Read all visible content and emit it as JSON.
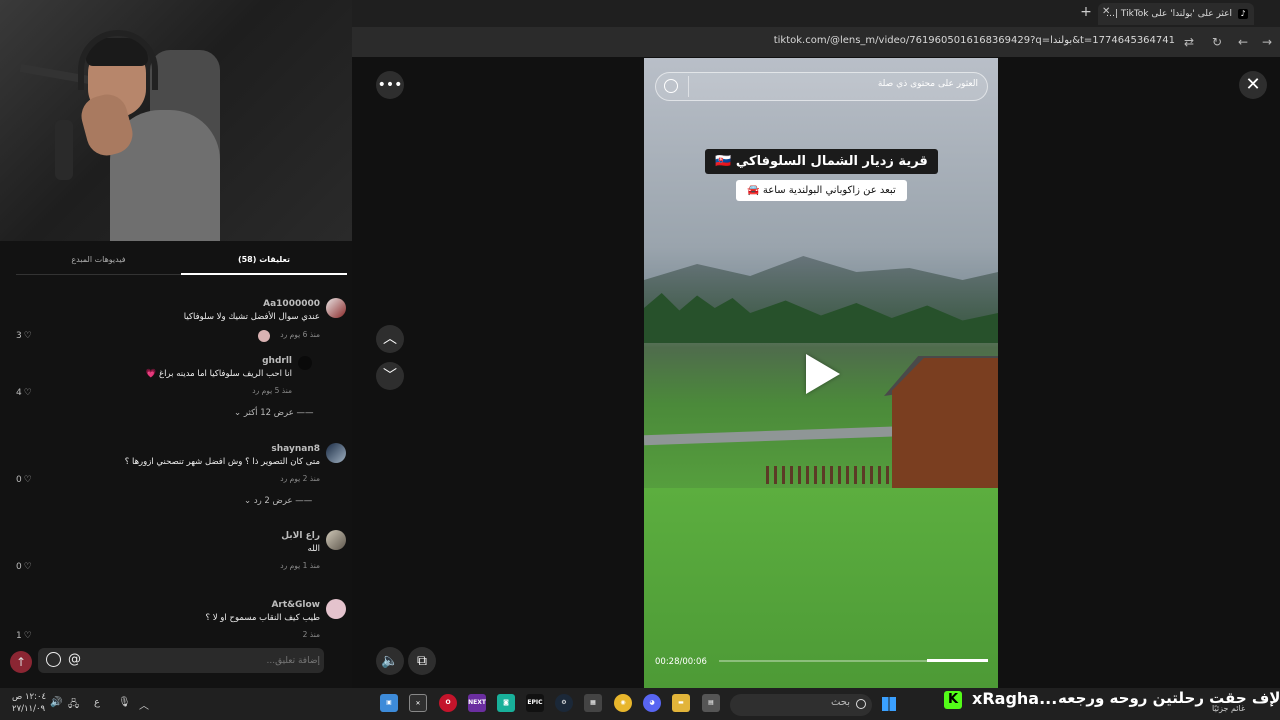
{
  "browser": {
    "tab_title": "اعثر على 'بولندا' على TikTok | بحث",
    "url": "tiktok.com/@lens_m/video/7619605016168369429?q=بولندا&t=1774645364741"
  },
  "panel": {
    "tab_comments": "تعليقات (58)",
    "tab_creator_videos": "فيديوهات المبدع",
    "comments": [
      {
        "user": "Aa1000000",
        "text": "عندي سوال الأفضل تشيك ولا سلوفاكيا",
        "meta": "منذ 6 يوم   رد",
        "likes": "3"
      },
      {
        "user": "ghdrll",
        "text": "انا احب الريف سلوفاكيا اما مدينه براغ 💗",
        "meta": "منذ 5 يوم   رد",
        "likes": "4"
      },
      {
        "user": "shaynan8",
        "text": "متى كان التصوير ذا ؟ وش افضل شهر تنصحني ازورها ؟",
        "meta": "منذ 2 يوم   رد",
        "likes": "0"
      },
      {
        "user": "راع الابل",
        "text": "الله",
        "meta": "منذ 1 يوم   رد",
        "likes": "0"
      },
      {
        "user": "Art&Glow",
        "text": "طيب كيف النقاب مسموح او لا ؟",
        "meta": "منذ 2",
        "likes": "1"
      }
    ],
    "more_replies_1": "عرض 12 أكثر",
    "more_replies_2": "عرض 2 رد",
    "comment_placeholder": "إضافة تعليق..."
  },
  "video": {
    "search_placeholder": "العثور على محتوى ذي صلة",
    "caption_title": "قرية زديار الشمال السلوفاكي 🇸🇰",
    "caption_sub": "تبعد عن زاكوباني البولندية ساعة 🚘",
    "time": "00:28/00:06",
    "progress": 0.23
  },
  "taskbar": {
    "ticker": "الإف حقت رحلتين روحه ورجعه",
    "channel": "xRagha...",
    "weather": "غائم جزئيًا",
    "search": "بحث",
    "time": "١٢:٠٤ ص",
    "date": "٢٧/١١/٠٩",
    "lang": "ع"
  },
  "colors": {
    "accent_red": "#fe2c55",
    "kick_green": "#53fc18"
  }
}
